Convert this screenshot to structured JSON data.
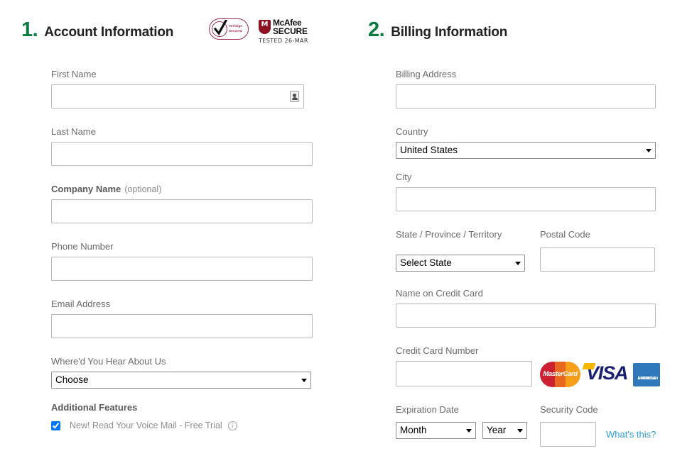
{
  "sections": {
    "account": {
      "number": "1.",
      "title": "Account Information"
    },
    "billing": {
      "number": "2.",
      "title": "Billing Information"
    }
  },
  "badges": {
    "verisign": {
      "line1": "VeriSign",
      "line2": "Secured"
    },
    "mcafee": {
      "line1": "McAfee",
      "line2": "SECURE",
      "shield_letter": "M",
      "tested": "TESTED 26-MAR"
    }
  },
  "account_fields": {
    "first_name": {
      "label": "First Name",
      "value": "",
      "placeholder": ""
    },
    "last_name": {
      "label": "Last Name",
      "value": "",
      "placeholder": ""
    },
    "company_name": {
      "label": "Company Name",
      "optional": "(optional)",
      "value": "",
      "placeholder": ""
    },
    "phone_number": {
      "label": "Phone Number",
      "value": "",
      "placeholder": ""
    },
    "email_address": {
      "label": "Email Address",
      "value": "",
      "placeholder": ""
    },
    "referral": {
      "label": "Where'd You Hear About Us",
      "selected": "Choose",
      "options": [
        "Choose"
      ]
    },
    "additional_features": {
      "label": "Additional Features",
      "checkbox_label": "New! Read Your Voice Mail - Free Trial",
      "checked": true,
      "info_glyph": "i"
    }
  },
  "billing_fields": {
    "billing_address": {
      "label": "Billing Address",
      "value": "",
      "placeholder": ""
    },
    "country": {
      "label": "Country",
      "selected": "United States",
      "options": [
        "United States"
      ]
    },
    "city": {
      "label": "City",
      "value": "",
      "placeholder": ""
    },
    "state": {
      "label": "State / Province / Territory",
      "selected": "Select State",
      "options": [
        "Select State"
      ]
    },
    "postal_code": {
      "label": "Postal Code",
      "value": "",
      "placeholder": ""
    },
    "name_on_card": {
      "label": "Name on Credit Card",
      "value": "",
      "placeholder": ""
    },
    "card_number": {
      "label": "Credit Card Number",
      "value": "",
      "placeholder": ""
    },
    "expiration": {
      "label": "Expiration Date",
      "month_selected": "Month",
      "month_options": [
        "Month"
      ],
      "year_selected": "Year",
      "year_options": [
        "Year"
      ]
    },
    "security_code": {
      "label": "Security Code",
      "value": "",
      "placeholder": "",
      "help_link": "What's this?"
    }
  },
  "card_logos": {
    "mastercard": "MasterCard",
    "visa": "VISA",
    "amex_line1": "AMERICAN",
    "amex_line2": "EXPRESS"
  },
  "colors": {
    "accent_green": "#0a7c42",
    "link_blue": "#2e9fd4",
    "label_gray": "#6b6b6b",
    "border_gray": "#b9b9b9",
    "verisign_maroon": "#9e2b4e",
    "mcafee_red": "#8f1022"
  }
}
